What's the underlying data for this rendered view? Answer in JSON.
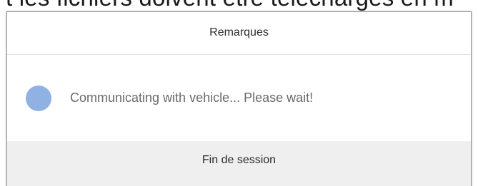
{
  "background_text": "t les fichiers doivent être téléchargés en m",
  "dialog": {
    "title": "Remarques",
    "message": "Communicating with vehicle... Please wait!",
    "end_session_label": "Fin de session"
  },
  "colors": {
    "spinner": "#8fb1e3",
    "footer_bg": "#efefef",
    "message_text": "#6a6a6a"
  },
  "icons": {
    "spinner": "loading-spinner-icon"
  }
}
